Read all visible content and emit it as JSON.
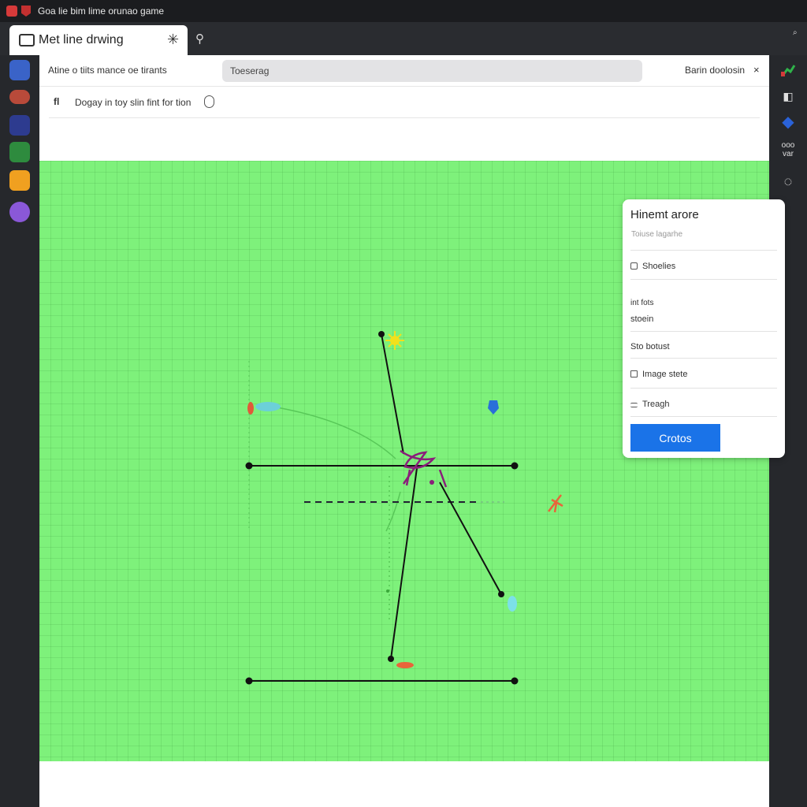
{
  "titlebar": {
    "title": "Goa lie bim lime orunao game"
  },
  "tab": {
    "title": "Met line drwing",
    "close_glyph": "✳",
    "search_glyph": "⚲"
  },
  "tabbar_right": {
    "glyph": "⌕"
  },
  "toolbar": {
    "left_label": "Atine o tiits mance oe tirants",
    "search_text": "Toeserag",
    "right_label": "Barin doolosin",
    "close_glyph": "×"
  },
  "subbar": {
    "icon_glyph": "fl",
    "text": "Dogay in toy slin fint for tion"
  },
  "dock": {
    "apps": [
      "app-1",
      "app-2",
      "app-3",
      "app-4",
      "app-5",
      "app-6"
    ]
  },
  "rail": {
    "glyphs": [
      "◧",
      "◆",
      "◌"
    ],
    "label_1": "ooo",
    "label_2": "var"
  },
  "panel": {
    "title": "Hinemt arore",
    "subtitle": "Toiuse lagarhe",
    "row_shoelies": "Shoelies",
    "row_int_fots": "int fots",
    "row_stoein": "stoein",
    "row_sto_botust": "Sto botust",
    "row_image_stete": "Image stete",
    "row_treagh": "Treagh",
    "button_label": "Crotos"
  },
  "colors": {
    "canvas_green": "#7ef17b",
    "accent_blue": "#1a73e8",
    "line_black": "#111111",
    "line_purple": "#8a1f7a"
  }
}
